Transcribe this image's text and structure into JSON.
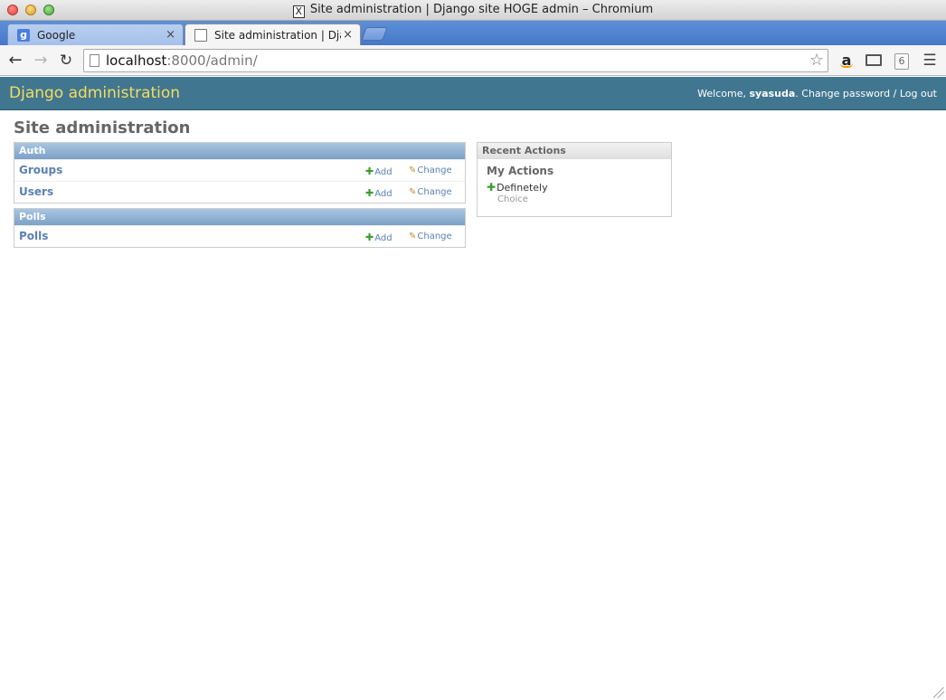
{
  "window": {
    "title": "Site administration | Django site HOGE admin – Chromium"
  },
  "tabs": [
    {
      "label": "Google",
      "favicon": "google-favicon",
      "close": "×"
    },
    {
      "label": "Site administration | Djang",
      "favicon": "document-icon",
      "close": "×"
    }
  ],
  "address_bar": {
    "host": "localhost",
    "rest": ":8000/admin/"
  },
  "toolbar": {
    "extension_badge": "6"
  },
  "header": {
    "branding": "Django administration",
    "welcome": "Welcome, ",
    "username": "syasuda",
    "change_password": "Change password",
    "separator": " / ",
    "log_out": "Log out"
  },
  "content": {
    "title": "Site administration"
  },
  "modules": [
    {
      "caption": "Auth",
      "rows": [
        {
          "name": "Groups",
          "add": "Add",
          "change": "Change"
        },
        {
          "name": "Users",
          "add": "Add",
          "change": "Change"
        }
      ]
    },
    {
      "caption": "Polls",
      "rows": [
        {
          "name": "Polls",
          "add": "Add",
          "change": "Change"
        }
      ]
    }
  ],
  "recent_actions": {
    "caption": "Recent Actions",
    "subheading": "My Actions",
    "entries": [
      {
        "label": "Definetely",
        "type": "Choice",
        "icon": "plus-icon"
      }
    ]
  },
  "colors": {
    "header_bg": "#417690",
    "branding": "#f5dd5d",
    "link": "#5b80b2",
    "add_icon": "#3a9d2e"
  }
}
